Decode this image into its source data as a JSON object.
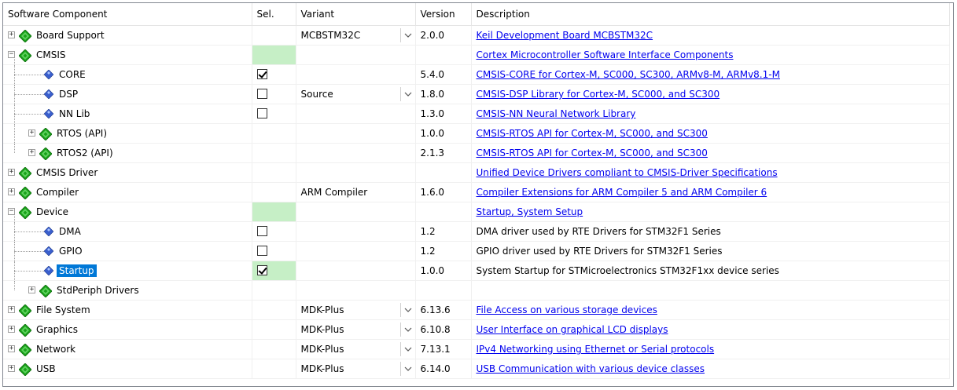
{
  "headers": {
    "name": "Software Component",
    "sel": "Sel.",
    "variant": "Variant",
    "version": "Version",
    "description": "Description"
  },
  "colors": {
    "selection": "#0078d7",
    "link": "#0000ee",
    "required": "#c6efc6",
    "pkg_icon": "#1aa11a",
    "comp_icon": "#3a5fcd"
  },
  "rows": [
    {
      "label": "Board Support",
      "level": 0,
      "kind": "package",
      "toggle": "+",
      "sel": "none",
      "variant": "MCBSTM32C",
      "dropdown": true,
      "version": "2.0.0",
      "description": "Keil Development Board MCBSTM32C",
      "link": true
    },
    {
      "label": "CMSIS",
      "level": 0,
      "kind": "package",
      "toggle": "-",
      "sel": "green",
      "variant": "",
      "dropdown": false,
      "version": "",
      "description": "Cortex Microcontroller Software Interface Components",
      "link": true
    },
    {
      "label": "CORE",
      "level": 1,
      "kind": "component",
      "toggle": "",
      "sel": "checked",
      "variant": "",
      "dropdown": false,
      "version": "5.4.0",
      "description": "CMSIS-CORE for Cortex-M, SC000, SC300, ARMv8-M, ARMv8.1-M",
      "link": true
    },
    {
      "label": "DSP",
      "level": 1,
      "kind": "component",
      "toggle": "",
      "sel": "unchecked",
      "variant": "Source",
      "dropdown": true,
      "version": "1.8.0",
      "description": "CMSIS-DSP Library for Cortex-M, SC000, and SC300",
      "link": true
    },
    {
      "label": "NN Lib",
      "level": 1,
      "kind": "component",
      "toggle": "",
      "sel": "unchecked",
      "variant": "",
      "dropdown": false,
      "version": "1.3.0",
      "description": "CMSIS-NN Neural Network Library",
      "link": true
    },
    {
      "label": "RTOS (API)",
      "level": 1,
      "kind": "package",
      "toggle": "+",
      "sel": "none",
      "variant": "",
      "dropdown": false,
      "version": "1.0.0",
      "description": "CMSIS-RTOS API for Cortex-M, SC000, and SC300",
      "link": true
    },
    {
      "label": "RTOS2 (API)",
      "level": 1,
      "kind": "package",
      "toggle": "+",
      "sel": "none",
      "variant": "",
      "dropdown": false,
      "version": "2.1.3",
      "description": "CMSIS-RTOS API for Cortex-M, SC000, and SC300",
      "link": true
    },
    {
      "label": "CMSIS Driver",
      "level": 0,
      "kind": "package",
      "toggle": "+",
      "sel": "none",
      "variant": "",
      "dropdown": false,
      "version": "",
      "description": "Unified Device Drivers compliant to CMSIS-Driver Specifications",
      "link": true
    },
    {
      "label": "Compiler",
      "level": 0,
      "kind": "package",
      "toggle": "+",
      "sel": "none",
      "variant": "ARM Compiler",
      "dropdown": false,
      "version": "1.6.0",
      "description": "Compiler Extensions for ARM Compiler 5 and ARM Compiler 6",
      "link": true
    },
    {
      "label": "Device",
      "level": 0,
      "kind": "package",
      "toggle": "-",
      "sel": "green",
      "variant": "",
      "dropdown": false,
      "version": "",
      "description": "Startup, System Setup",
      "link": true
    },
    {
      "label": "DMA",
      "level": 1,
      "kind": "component",
      "toggle": "",
      "sel": "unchecked",
      "variant": "",
      "dropdown": false,
      "version": "1.2",
      "description": "DMA driver used by RTE Drivers for STM32F1 Series",
      "link": false
    },
    {
      "label": "GPIO",
      "level": 1,
      "kind": "component",
      "toggle": "",
      "sel": "unchecked",
      "variant": "",
      "dropdown": false,
      "version": "1.2",
      "description": "GPIO driver used by RTE Drivers for STM32F1 Series",
      "link": false
    },
    {
      "label": "Startup",
      "level": 1,
      "kind": "component",
      "toggle": "",
      "sel": "checked-green",
      "variant": "",
      "dropdown": false,
      "version": "1.0.0",
      "description": "System Startup for STMicroelectronics STM32F1xx device series",
      "link": false,
      "selected": true
    },
    {
      "label": "StdPeriph Drivers",
      "level": 1,
      "kind": "package",
      "toggle": "+",
      "sel": "none",
      "variant": "",
      "dropdown": false,
      "version": "",
      "description": "",
      "link": false
    },
    {
      "label": "File System",
      "level": 0,
      "kind": "package",
      "toggle": "+",
      "sel": "none",
      "variant": "MDK-Plus",
      "dropdown": true,
      "version": "6.13.6",
      "description": "File Access on various storage devices",
      "link": true
    },
    {
      "label": "Graphics",
      "level": 0,
      "kind": "package",
      "toggle": "+",
      "sel": "none",
      "variant": "MDK-Plus",
      "dropdown": true,
      "version": "6.10.8",
      "description": "User Interface on graphical LCD displays",
      "link": true
    },
    {
      "label": "Network",
      "level": 0,
      "kind": "package",
      "toggle": "+",
      "sel": "none",
      "variant": "MDK-Plus",
      "dropdown": true,
      "version": "7.13.1",
      "description": "IPv4 Networking using Ethernet or Serial protocols",
      "link": true
    },
    {
      "label": "USB",
      "level": 0,
      "kind": "package",
      "toggle": "+",
      "sel": "none",
      "variant": "MDK-Plus",
      "dropdown": true,
      "version": "6.14.0",
      "description": "USB Communication with various device classes",
      "link": true
    }
  ]
}
